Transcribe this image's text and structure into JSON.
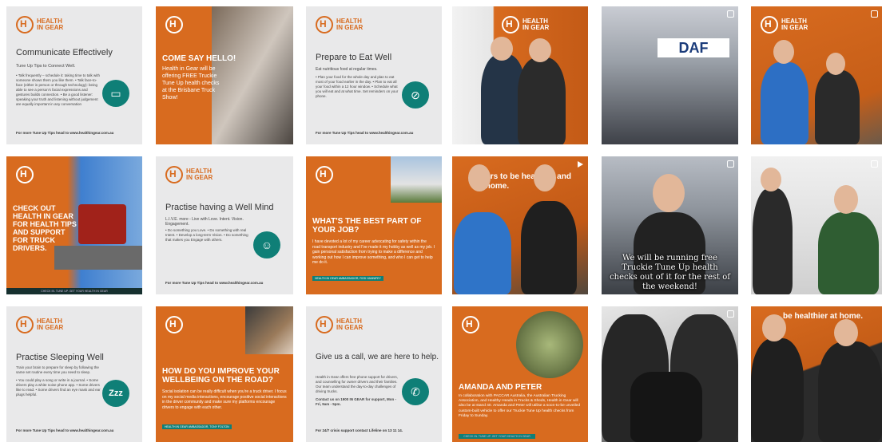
{
  "tiles": {
    "t1": {
      "logo": "HEALTH IN GEAR",
      "title": "Communicate Effectively",
      "sub": "Tune Up Tips to Connect Well.",
      "body": "• Talk frequently – schedule it: taking time to talk with someone shows them you like them. • Talk face-to-face (either in person or through technology): being able to see a person's facial expressions and gestures builds connection. • Be a good listener: speaking your truth and listening without judgement are equally important in any conversation",
      "footer": "For more Tune Up Tips head to www.healthingear.com.au"
    },
    "t2": {
      "title": "COME SAY HELLO!",
      "body": "Health in Gear will be offering FREE Truckie Tune Up health checks at the Brisbane Truck Show!"
    },
    "t3": {
      "logo": "HEALTH IN GEAR",
      "title": "Prepare to Eat Well",
      "sub": "Eat nutritious food at regular times.",
      "body": "• Plan your food for the whole day and plan to eat most of your food earlier in the day. • Plan to eat all your food within a 12 hour window. • Schedule what you will eat and at what time. Set reminders on your phone.",
      "footer": "For more Tune Up Tips head to www.healthingear.com.au"
    },
    "t4": {
      "banner": "HEALTH IN GEAR"
    },
    "t5": {
      "sign": "DAF"
    },
    "t6": {
      "banner": "HEALTH IN GEAR"
    },
    "t7": {
      "title": "CHECK OUT HEALTH IN GEAR FOR HEALTH TIPS AND SUPPORT FOR TRUCK DRIVERS.",
      "strip": "CHECK IN. TUNE UP. GET YOUR HEALTH IN GEAR"
    },
    "t8": {
      "logo": "HEALTH IN GEAR",
      "title": "Practise having a Well Mind",
      "sub": "L.I.V.E. more - Live with Love. Intent. Vision. Engagement.",
      "body": "• Do something you Love. • Do something with real Intent. • Develop a long-term Vision. • Do something that makes you Engage with others.",
      "footer": "For more Tune Up Tips head to www.healthingear.com.au"
    },
    "t9": {
      "title": "WHAT'S THE BEST PART OF YOUR JOB?",
      "body": "I have devoted a lot of my career advocating for safety within the road transport industry and I've made it my hobby as well as my job. I gain personal satisfaction from trying to make a difference and working out how I can improve something, and who I can get to help me do it.",
      "tag": "HEALTH IN GEAR AMBASSADOR, ROD HANNIFEY"
    },
    "t10": {
      "banner": "rivers to be hea road and at home."
    },
    "t11": {
      "caption": "We will be running free Truckie Tune Up health checks out of it for the rest of the weekend!"
    },
    "t12": {},
    "t13": {
      "logo": "HEALTH IN GEAR",
      "title": "Practise Sleeping Well",
      "sub": "Train your brain to prepare for sleep by following the same set routine every time you need to sleep.",
      "body": "• You could play a song or write in a journal. • Some drivers play a white noise phone app. • Some drivers like to read. • Some drivers find an eye mask and ear plugs helpful.",
      "footer": "For more Tune Up Tips head to www.healthingear.com.au",
      "icon": "Zzz"
    },
    "t14": {
      "title": "HOW DO YOU IMPROVE YOUR WELLBEING ON THE ROAD?",
      "body": "Social isolation can be really difficult when you're a truck driver. I focus on my social media interactions, encourage positive social interactions in the driver community and make sure my platforms encourage drivers to engage with each other.",
      "tag": "HEALTH IN GEAR AMBASSADOR, TONY FOLTON"
    },
    "t15": {
      "logo": "HEALTH IN GEAR",
      "title": "Give us a call, we are here to help.",
      "body": "Health in Gear offers free phone support for drivers, and counselling for owner drivers and their families. Our team understand the day-to-day challenges of driving trucks.",
      "contact": "Contact us on 1900 IN GEAR for support, Mon - Fri, 9am - 5pm.",
      "footer": "For 24/7 crisis support contact Lifeline on 13 11 14."
    },
    "t16": {
      "title": "AMANDA AND PETER",
      "body": "In collaboration with PACCAR Australia, the Australian Trucking Association, and Healthy Heads in Trucks & Sheds, Health in Gear will also be at stand 40. Amanda and Peter will utilise a soon-to-be unveiled custom-built vehicle to offer our Truckie Tune Up health checks from Friday to Sunday.",
      "strip": "CHECK IN. TUNE UP. GET YOUR HEALTH IN GEAR"
    },
    "t17": {},
    "t18": {
      "banner": "be healthier at home."
    }
  },
  "colors": {
    "orange": "#d86b1f",
    "teal": "#0f7f77",
    "grey": "#e9e9ea"
  }
}
